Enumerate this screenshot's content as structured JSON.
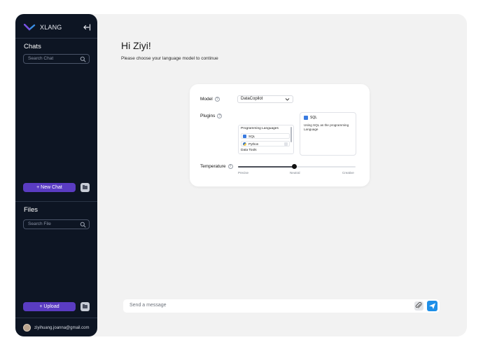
{
  "sidebar": {
    "brand": "XLANG",
    "chats_title": "Chats",
    "search_chat_placeholder": "Search Chat",
    "new_chat_label": "+ New Chat",
    "files_title": "Files",
    "search_file_placeholder": "Search File",
    "upload_label": "+ Upload",
    "user_email": "ziyihuang.joanna@gmail.com"
  },
  "main": {
    "greeting": "Hi Ziyi!",
    "subtitle": "Please choose your language model to continue",
    "model_label": "Model",
    "model_value": "DataCopilot",
    "plugins_label": "Plugins",
    "plugin_groups": {
      "programming_header": "Programming Languages",
      "items": [
        {
          "name": "SQL",
          "icon": "database-icon"
        },
        {
          "name": "Python",
          "icon": "python-icon"
        }
      ],
      "data_tools_header": "Data Tools"
    },
    "plugin_detail": {
      "name": "SQL",
      "description": "Using SQL as the programming Language"
    },
    "temperature_label": "Temperature",
    "temperature_value": 0.48,
    "temperature_ticks": [
      "Precise",
      "Neutral",
      "Creative"
    ],
    "message_placeholder": "Send a message"
  },
  "colors": {
    "sidebar_bg": "#0d1523",
    "accent_purple": "#5a3cc2",
    "send_blue": "#1e8fe8",
    "page_bg": "#f2f2f2"
  }
}
